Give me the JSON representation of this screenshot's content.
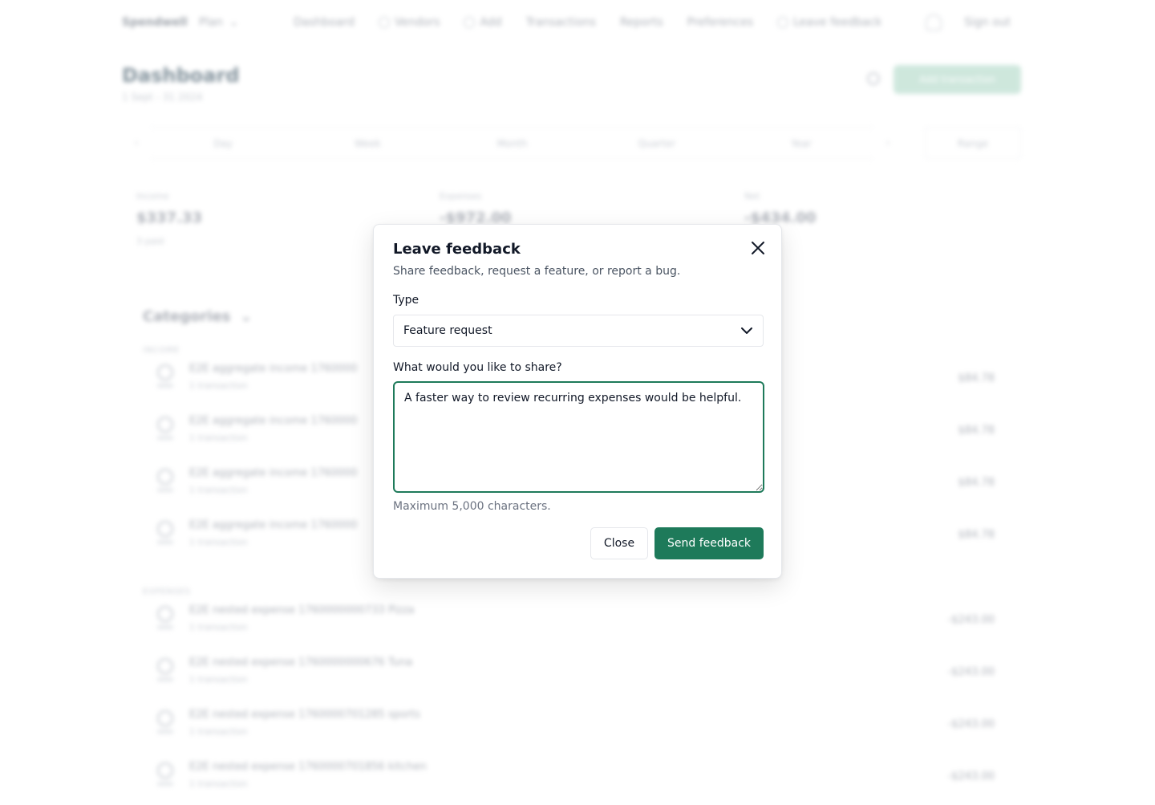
{
  "background": {
    "nav": {
      "brand": "Spendwell",
      "plan": "Plan",
      "links": [
        "Dashboard",
        "Vendors",
        "Add",
        "Transactions",
        "Reports",
        "Preferences",
        "Leave feedback"
      ],
      "sign_out": "Sign out"
    },
    "page": {
      "title": "Dashboard",
      "date": "1 Sept - 31 2024",
      "add_button": "Add transaction"
    },
    "range": {
      "segments": [
        "Day",
        "Week",
        "Month",
        "Quarter",
        "Year"
      ],
      "all": "Range"
    },
    "summary": [
      {
        "label": "Income",
        "value": "$337.33",
        "sub": "3 paid"
      },
      {
        "label": "Expenses",
        "value": "-$972.00",
        "sub": ""
      },
      {
        "label": "Net",
        "value": "-$434.00",
        "sub": ""
      }
    ],
    "categories": {
      "title": "Categories",
      "groups": [
        {
          "label": "INCOME",
          "rows": [
            {
              "name": "E2E aggregate income 1760000",
              "sub": "1 transaction",
              "amount": "$84.78"
            },
            {
              "name": "E2E aggregate income 1760000",
              "sub": "1 transaction",
              "amount": "$84.78"
            },
            {
              "name": "E2E aggregate income 1760000",
              "sub": "1 transaction",
              "amount": "$84.78"
            },
            {
              "name": "E2E aggregate income 1760000",
              "sub": "1 transaction",
              "amount": "$84.78"
            }
          ]
        },
        {
          "label": "EXPENSES",
          "rows": [
            {
              "name": "E2E nested expense 1760000000733 Pizza",
              "sub": "1 transaction",
              "amount": "-$243.00"
            },
            {
              "name": "E2E nested expense 1760000000676 Tuna",
              "sub": "1 transaction",
              "amount": "-$243.00"
            },
            {
              "name": "E2E nested expense 1760000701285 sports",
              "sub": "1 transaction",
              "amount": "-$243.00"
            },
            {
              "name": "E2E nested expense 1760000701856 kitchen",
              "sub": "1 transaction",
              "amount": "-$243.00"
            }
          ]
        }
      ]
    }
  },
  "modal": {
    "title": "Leave feedback",
    "subtitle": "Share feedback, request a feature, or report a bug.",
    "type_label": "Type",
    "type_value": "Feature request",
    "message_label": "What would you like to share?",
    "message_value": "A faster way to review recurring expenses would be helpful.",
    "hint": "Maximum 5,000 characters.",
    "close_label": "Close",
    "send_label": "Send feedback"
  },
  "colors": {
    "accent": "#1e7a5a",
    "accent_light": "#a7d4c1",
    "border": "#e5e7eb",
    "muted_text": "#6b7280"
  },
  "icons": [
    "close-icon",
    "chevron-down-icon"
  ]
}
